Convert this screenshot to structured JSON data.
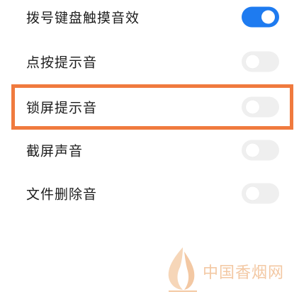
{
  "settings": {
    "items": [
      {
        "label": "拨号键盘触摸音效",
        "enabled": true
      },
      {
        "label": "点按提示音",
        "enabled": false
      },
      {
        "label": "锁屏提示音",
        "enabled": false
      },
      {
        "label": "截屏声音",
        "enabled": false
      },
      {
        "label": "文件删除音",
        "enabled": false
      }
    ]
  },
  "colors": {
    "toggle_on": "#1e7bf0",
    "toggle_off": "#efefef",
    "highlight": "#f07a3e",
    "watermark": "#f3c8a3"
  },
  "watermark": {
    "text": "中国香烟网",
    "icon": "flame-leaf-logo"
  }
}
